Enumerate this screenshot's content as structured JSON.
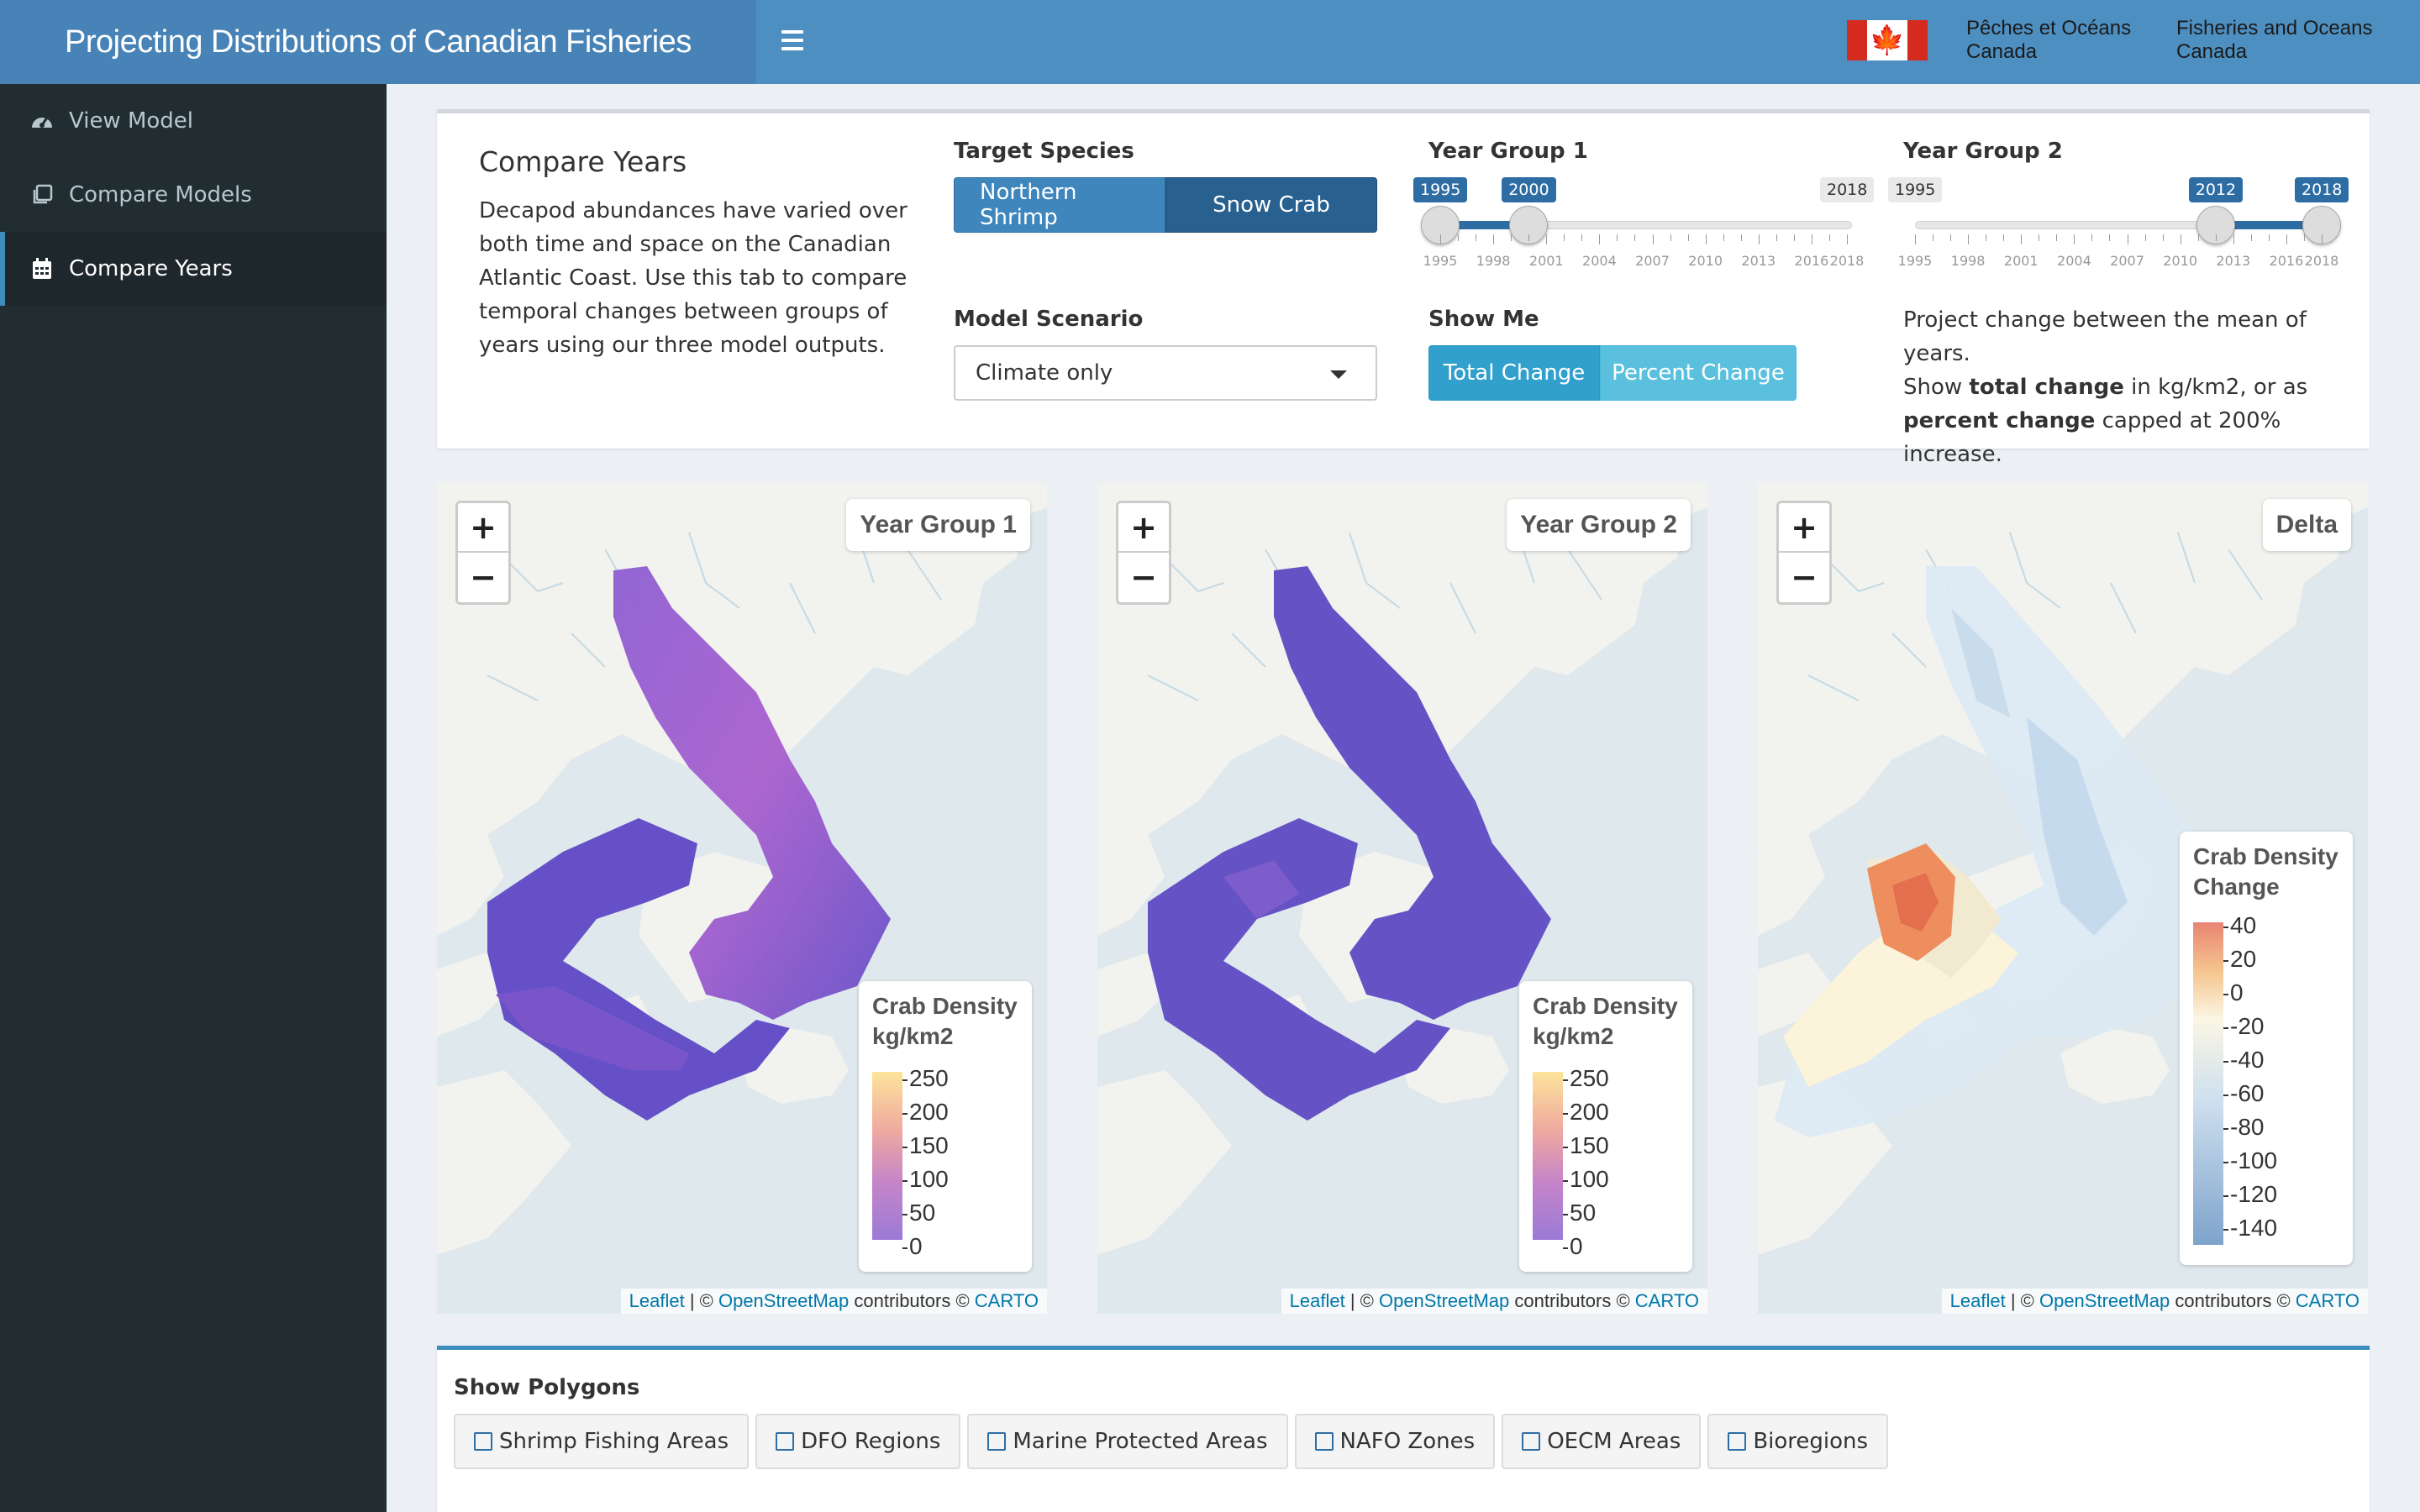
{
  "header": {
    "title": "Projecting Distributions of Canadian Fisheries",
    "dfo_fr_line1": "Pêches et Océans",
    "dfo_fr_line2": "Canada",
    "dfo_en_line1": "Fisheries and Oceans",
    "dfo_en_line2": "Canada"
  },
  "sidebar": {
    "items": [
      {
        "label": "View Model",
        "icon": "dashboard-icon"
      },
      {
        "label": "Compare Models",
        "icon": "clone-icon"
      },
      {
        "label": "Compare Years",
        "icon": "calendar-icon",
        "active": true
      }
    ]
  },
  "controls": {
    "title": "Compare Years",
    "intro": "Decapod abundances have varied over both time and space on the Canadian Atlantic Coast. Use this tab to compare temporal changes between groups of years using our three model outputs.",
    "target_species_label": "Target Species",
    "species_options": [
      "Northern Shrimp",
      "Snow Crab"
    ],
    "species_selected": "Snow Crab",
    "model_scenario_label": "Model Scenario",
    "model_scenario_value": "Climate only",
    "year_group_1": {
      "label": "Year Group 1",
      "min": 1995,
      "max": 2018,
      "from": 1995,
      "to": 2000
    },
    "year_group_2": {
      "label": "Year Group 2",
      "min": 1995,
      "max": 2018,
      "from": 2012,
      "to": 2018
    },
    "slider_ticks": [
      "1995",
      "1998",
      "2001",
      "2004",
      "2007",
      "2010",
      "2013",
      "2016",
      "2018"
    ],
    "show_me_label": "Show Me",
    "show_me_options": [
      "Total Change",
      "Percent Change"
    ],
    "show_me_selected": "Total Change",
    "description_1": "Project change between the mean of years.",
    "description_2a": "Show ",
    "description_2b": "total change",
    "description_2c": " in kg/km2, or as",
    "description_3a": "percent change",
    "description_3b": " capped at 200% increase."
  },
  "maps": [
    {
      "title": "Year Group 1",
      "legend_title_1": "Crab Density",
      "legend_title_2": "kg/km2",
      "legend_labels": [
        "250",
        "200",
        "150",
        "100",
        "50",
        "0"
      ]
    },
    {
      "title": "Year Group 2",
      "legend_title_1": "Crab Density",
      "legend_title_2": "kg/km2",
      "legend_labels": [
        "250",
        "200",
        "150",
        "100",
        "50",
        "0"
      ]
    },
    {
      "title": "Delta",
      "legend_title_1": "Crab Density",
      "legend_title_2": "Change",
      "legend_labels": [
        "40",
        "20",
        "0",
        "-20",
        "-40",
        "-60",
        "-80",
        "-100",
        "-120",
        "-140"
      ]
    }
  ],
  "attribution": {
    "leaflet": "Leaflet",
    "sep": " | © ",
    "osm": "OpenStreetMap",
    "contrib": " contributors © ",
    "carto": "CARTO"
  },
  "zoom": {
    "in": "+",
    "out": "−"
  },
  "polygons": {
    "label": "Show Polygons",
    "options": [
      "Shrimp Fishing Areas",
      "DFO Regions",
      "Marine Protected Areas",
      "NAFO Zones",
      "OECM Areas",
      "Bioregions"
    ]
  },
  "colors": {
    "header": "#4d8fc0",
    "sidebar": "#222d32",
    "primary": "#2e6da4",
    "info": "#5bc0de"
  }
}
